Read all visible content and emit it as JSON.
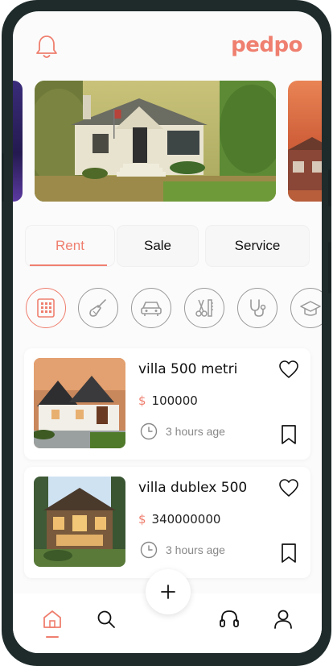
{
  "app": {
    "logo_text": "pedpo",
    "accent_color": "#ef7f6f"
  },
  "header": {
    "notification_icon": "bell-icon"
  },
  "tabs": [
    {
      "label": "Rent",
      "active": true
    },
    {
      "label": "Sale",
      "active": false
    },
    {
      "label": "Service",
      "active": false
    }
  ],
  "categories": [
    {
      "icon": "building-icon",
      "active": true
    },
    {
      "icon": "broom-icon",
      "active": false
    },
    {
      "icon": "car-icon",
      "active": false
    },
    {
      "icon": "scissors-comb-icon",
      "active": false
    },
    {
      "icon": "stethoscope-icon",
      "active": false
    },
    {
      "icon": "graduation-cap-icon",
      "active": false
    }
  ],
  "listings": [
    {
      "title": "villa 500 metri",
      "currency": "$",
      "price": "100000",
      "time": "3 hours age"
    },
    {
      "title": "villa dublex 500",
      "currency": "$",
      "price": "340000000",
      "time": "3 hours age"
    }
  ],
  "bottom_nav": {
    "items": [
      "home-icon",
      "search-icon",
      "headset-icon",
      "user-icon"
    ],
    "active": "home-icon",
    "fab_icon": "plus-icon"
  }
}
